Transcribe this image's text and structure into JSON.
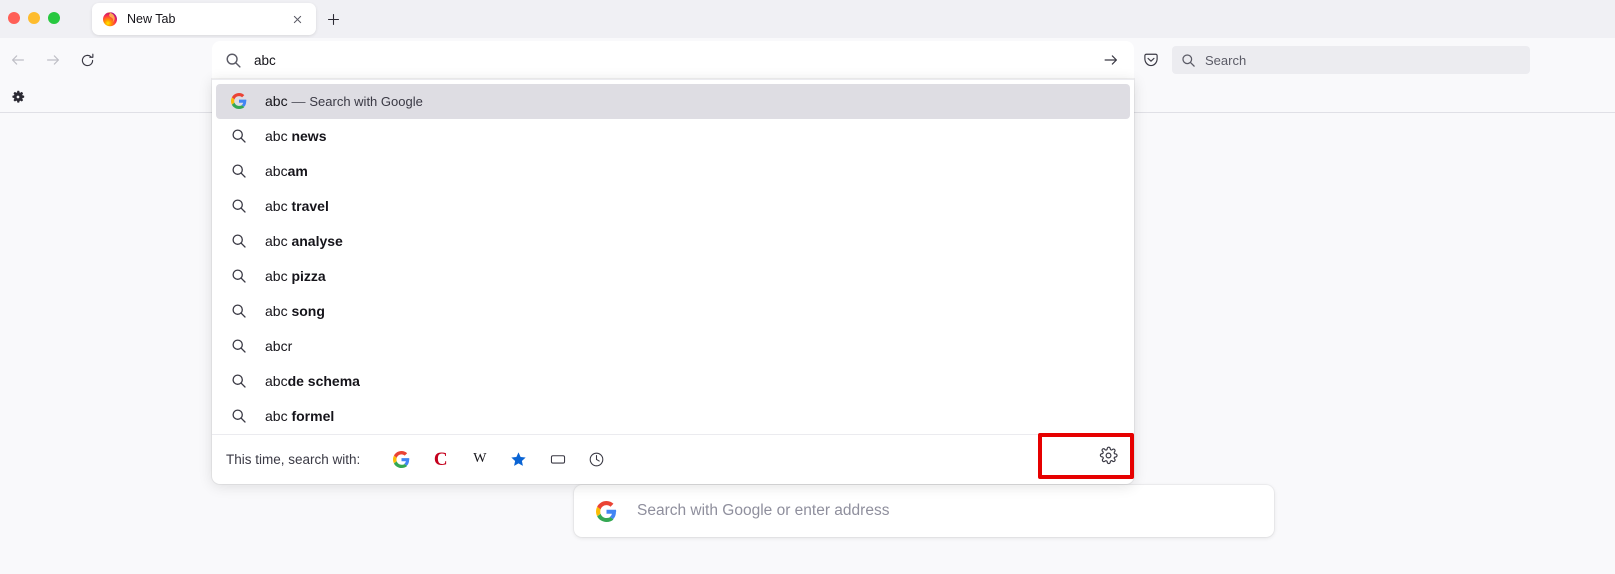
{
  "window": {
    "platform": "macos",
    "traffic_lights": [
      "close",
      "minimize",
      "maximize"
    ]
  },
  "tabs": {
    "active_tab_title": "New Tab",
    "favicon": "firefox-logo-icon",
    "close_label": "×",
    "new_tab_label": "+"
  },
  "navigation": {
    "back": "back-arrow-icon",
    "forward": "forward-arrow-icon",
    "reload": "reload-icon"
  },
  "urlbar": {
    "value": "abc",
    "placeholder": "Search with Google or enter address",
    "icon": "search-icon",
    "go_icon": "arrow-right-icon"
  },
  "toolbar_right": {
    "pocket_label": "Pocket",
    "search_placeholder": "Search"
  },
  "bookmarks_toolbar": {
    "gear_label": "Settings"
  },
  "results": {
    "items": [
      {
        "icon": "google-logo-icon",
        "prefix": "abc",
        "dash": " — ",
        "suffix": "Search with Google",
        "bold": false,
        "selected": true,
        "type": "search-engine"
      },
      {
        "icon": "search-icon",
        "prefix": "abc ",
        "suffix": "news",
        "bold": true,
        "selected": false,
        "type": "suggestion"
      },
      {
        "icon": "search-icon",
        "prefix": "abc",
        "suffix": "am",
        "bold": true,
        "selected": false,
        "type": "suggestion"
      },
      {
        "icon": "search-icon",
        "prefix": "abc ",
        "suffix": "travel",
        "bold": true,
        "selected": false,
        "type": "suggestion"
      },
      {
        "icon": "search-icon",
        "prefix": "abc ",
        "suffix": "analyse",
        "bold": true,
        "selected": false,
        "type": "suggestion"
      },
      {
        "icon": "search-icon",
        "prefix": "abc ",
        "suffix": "pizza",
        "bold": true,
        "selected": false,
        "type": "suggestion"
      },
      {
        "icon": "search-icon",
        "prefix": "abc ",
        "suffix": "song",
        "bold": true,
        "selected": false,
        "type": "suggestion"
      },
      {
        "icon": "search-icon",
        "prefix": "abcr",
        "suffix": "",
        "bold": true,
        "selected": false,
        "type": "suggestion"
      },
      {
        "icon": "search-icon",
        "prefix": "abc",
        "suffix": "de schema",
        "bold": true,
        "selected": false,
        "type": "suggestion"
      },
      {
        "icon": "search-icon",
        "prefix": "abc ",
        "suffix": "formel",
        "bold": true,
        "selected": false,
        "type": "suggestion"
      }
    ]
  },
  "one_off_search": {
    "label": "This time, search with:",
    "engines": [
      {
        "name": "google",
        "icon": "google-logo-icon",
        "title": "Google"
      },
      {
        "name": "chambers",
        "icon": "red-c-icon",
        "title": "C"
      },
      {
        "name": "wikipedia",
        "icon": "wikipedia-w-icon",
        "title": "W"
      },
      {
        "name": "bookmarks",
        "icon": "star-icon",
        "title": "Bookmarks"
      },
      {
        "name": "tabs",
        "icon": "tab-rectangle-icon",
        "title": "Tabs"
      },
      {
        "name": "history",
        "icon": "clock-icon",
        "title": "History"
      }
    ],
    "settings_icon": "gear-icon",
    "settings_title": "Search settings"
  },
  "newtab": {
    "search_placeholder": "Search with Google or enter address",
    "logo": "google-logo-icon"
  },
  "highlight": {
    "color": "#e60000",
    "target": "search-settings-button"
  },
  "colors": {
    "chrome_bg": "#f0f0f4",
    "toolbar_bg": "#f9f9fb",
    "popup_bg": "#ffffff",
    "selected_row": "#dedde3",
    "accent_red": "#e60000",
    "star_blue": "#0a64d4",
    "c_red": "#c4001d"
  }
}
